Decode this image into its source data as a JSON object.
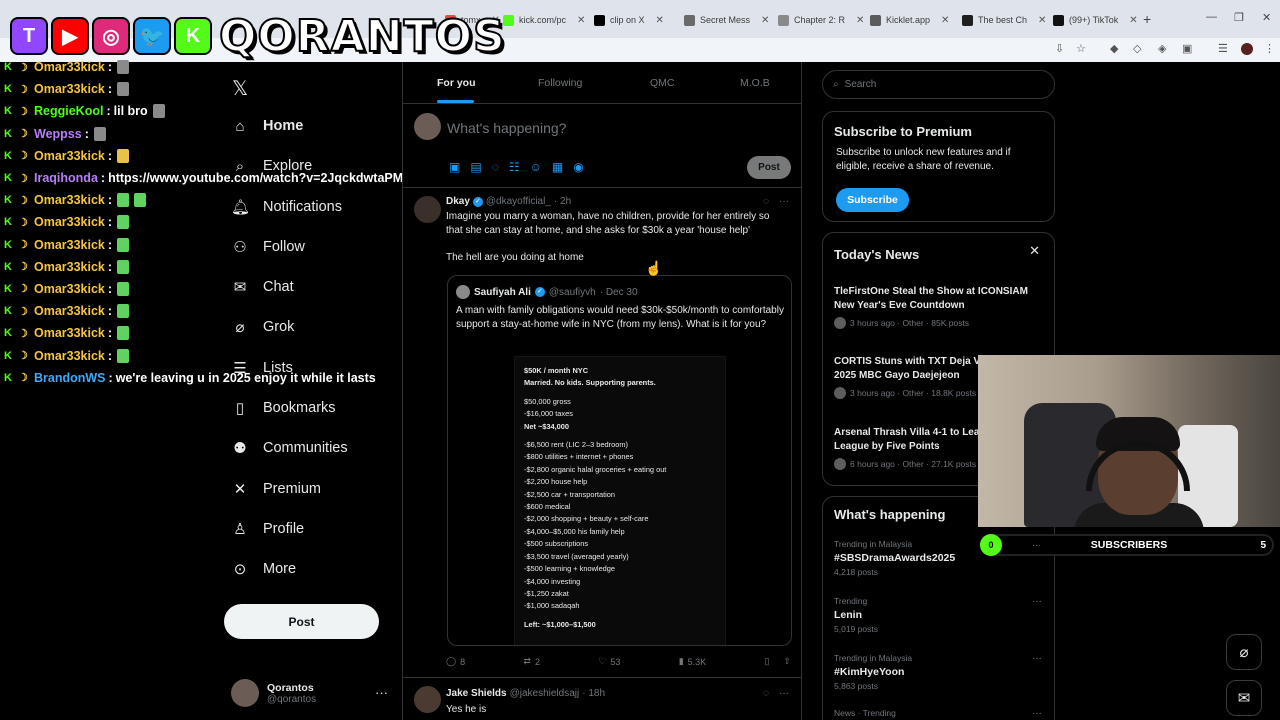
{
  "browser": {
    "tabs": [
      {
        "label": "tomx",
        "color": "#e54d42"
      },
      {
        "label": "kick.com/pc",
        "color": "#53fc18"
      },
      {
        "label": "clip on X",
        "color": "#000000"
      },
      {
        "label": "Secret Mess",
        "color": "#6a6a6a"
      },
      {
        "label": "Chapter 2: R",
        "color": "#8a8a8a"
      },
      {
        "label": "Kicklet.app",
        "color": "#5b5b5b"
      },
      {
        "label": "The best Ch",
        "color": "#1f1f1f"
      },
      {
        "label": "(99+) TikTok",
        "color": "#111111"
      }
    ]
  },
  "overlay": {
    "brand_icons": [
      {
        "name": "twitch-icon",
        "glyph": "T",
        "color": "#9146ff"
      },
      {
        "name": "youtube-icon",
        "glyph": "▶",
        "color": "#ff0000"
      },
      {
        "name": "instagram-icon",
        "glyph": "◎",
        "color": "#dd2a7b"
      },
      {
        "name": "twitter-icon",
        "glyph": "🐦",
        "color": "#1d9bf0"
      },
      {
        "name": "kick-icon",
        "glyph": "K",
        "color": "#53fc18"
      }
    ],
    "logo_text": "QORANTOS"
  },
  "chat": [
    {
      "user": "Omar33kick",
      "color": "#f5c542",
      "msg": "",
      "emote": "grey"
    },
    {
      "user": "Omar33kick",
      "color": "#f5c542",
      "msg": "",
      "emote": "grey"
    },
    {
      "user": "ReggieKool",
      "color": "#53fc18",
      "msg": "lil bro",
      "emote": "grey"
    },
    {
      "user": "Weppss",
      "color": "#b77ff5",
      "msg": "",
      "emote": "grey"
    },
    {
      "user": "Omar33kick",
      "color": "#f5c542",
      "msg": "",
      "emote": "gold"
    },
    {
      "user": "Iraqihonda",
      "color": "#b77ff5",
      "msg": "https://www.youtube.com/watch?v=2JqckdwtaPM",
      "emote": ""
    },
    {
      "user": "Omar33kick",
      "color": "#f5c542",
      "msg": "",
      "emote": "green2"
    },
    {
      "user": "Omar33kick",
      "color": "#f5c542",
      "msg": "",
      "emote": "green"
    },
    {
      "user": "Omar33kick",
      "color": "#f5c542",
      "msg": "",
      "emote": "green"
    },
    {
      "user": "Omar33kick",
      "color": "#f5c542",
      "msg": "",
      "emote": "green"
    },
    {
      "user": "Omar33kick",
      "color": "#f5c542",
      "msg": "",
      "emote": "green"
    },
    {
      "user": "Omar33kick",
      "color": "#f5c542",
      "msg": "",
      "emote": "green"
    },
    {
      "user": "Omar33kick",
      "color": "#f5c542",
      "msg": "",
      "emote": "green"
    },
    {
      "user": "Omar33kick",
      "color": "#f5c542",
      "msg": "",
      "emote": "green"
    },
    {
      "user": "BrandonWS",
      "color": "#3fa9f5",
      "msg": "we're leaving u in 2025 enjoy it while it lasts",
      "emote": ""
    }
  ],
  "nav": {
    "items": [
      {
        "label": "Home",
        "icon": "home-icon"
      },
      {
        "label": "Explore",
        "icon": "search-icon"
      },
      {
        "label": "Notifications",
        "icon": "bell-icon"
      },
      {
        "label": "Follow",
        "icon": "follow-icon"
      },
      {
        "label": "Chat",
        "icon": "mail-icon"
      },
      {
        "label": "Grok",
        "icon": "grok-icon"
      },
      {
        "label": "Lists",
        "icon": "list-icon"
      },
      {
        "label": "Bookmarks",
        "icon": "bookmark-icon"
      },
      {
        "label": "Communities",
        "icon": "communities-icon"
      },
      {
        "label": "Premium",
        "icon": "x-icon"
      },
      {
        "label": "Profile",
        "icon": "person-icon"
      },
      {
        "label": "More",
        "icon": "more-icon"
      }
    ],
    "post_label": "Post",
    "account_name": "Qorantos",
    "account_handle": "@qorantos"
  },
  "feed": {
    "tabs": [
      "For you",
      "Following",
      "QMC",
      "M.O.B"
    ],
    "composer_placeholder": "What's happening?",
    "composer_post": "Post",
    "tweet1": {
      "name": "Dkay",
      "handle": "@dkayofficial_",
      "time": "· 2h",
      "text": "Imagine you marry a woman, have no children, provide for her entirely so that she can stay at home, and she asks for $30k a year 'house help'",
      "text2": "The hell are you doing at home",
      "quote": {
        "name": "Saufiyah Ali",
        "handle": "@saufiyvh",
        "time": "· Dec 30",
        "text": "A man with family obligations would need $30k-$50k/month to comfortably support a stay-at-home wife in NYC (from my lens). What is it for you?",
        "image_lines": [
          {
            "t": "$50K / month NYC",
            "b": true
          },
          {
            "t": "Married. No kids. Supporting parents.",
            "b": true
          },
          {
            "t": "",
            "gap": true
          },
          {
            "t": "$50,000 gross"
          },
          {
            "t": "-$16,000 taxes"
          },
          {
            "t": "Net ~$34,000",
            "b": true
          },
          {
            "t": "",
            "gap": true
          },
          {
            "t": "-$6,500 rent (LIC 2–3 bedroom)"
          },
          {
            "t": "-$800 utilities + internet + phones"
          },
          {
            "t": "-$2,800 organic halal groceries + eating out"
          },
          {
            "t": "-$2,200 house help"
          },
          {
            "t": "-$2,500 car + transportation"
          },
          {
            "t": "-$600 medical"
          },
          {
            "t": "-$2,000 shopping + beauty + self-care"
          },
          {
            "t": "-$4,000–$5,000 his family help"
          },
          {
            "t": "-$500 subscriptions"
          },
          {
            "t": "-$3,500 travel (averaged yearly)"
          },
          {
            "t": "-$500 learning + knowledge"
          },
          {
            "t": "-$4,000 investing"
          },
          {
            "t": "-$1,250 zakat"
          },
          {
            "t": "-$1,000 sadaqah"
          },
          {
            "t": "",
            "gap": true
          },
          {
            "t": "Left: ~$1,000–$1,500",
            "b": true
          }
        ]
      },
      "replies": "8",
      "reposts": "2",
      "likes": "53",
      "views": "5.3K"
    },
    "tweet2": {
      "name": "Jake Shields",
      "handle": "@jakeshieldsajj",
      "time": "· 18h",
      "text": "Yes he is"
    }
  },
  "right": {
    "search_placeholder": "Search",
    "premium": {
      "title": "Subscribe to Premium",
      "body": "Subscribe to unlock new features and if eligible, receive a share of revenue.",
      "button": "Subscribe"
    },
    "news": {
      "title": "Today's News",
      "items": [
        {
          "headline": "TleFirstOne Steal the Show at ICONSIAM New Year's Eve Countdown",
          "meta": "3 hours ago · Other · 85K posts"
        },
        {
          "headline": "CORTIS Stuns with TXT Deja Vu Cover at 2025 MBC Gayo Daejejeon",
          "meta": "3 hours ago · Other · 18.8K posts"
        },
        {
          "headline": "Arsenal Thrash Villa 4-1 to Lead Premier League by Five Points",
          "meta": "6 hours ago · Other · 27.1K posts"
        }
      ]
    },
    "happening": {
      "title": "What's happening",
      "trends": [
        {
          "category": "Trending in Malaysia",
          "name": "#SBSDramaAwards2025",
          "posts": "4,218 posts"
        },
        {
          "category": "Trending",
          "name": "Lenin",
          "posts": "5,019 posts"
        },
        {
          "category": "Trending in Malaysia",
          "name": "#KimHyeYoon",
          "posts": "5,863 posts"
        },
        {
          "category": "News · Trending",
          "name": "",
          "posts": ""
        }
      ]
    }
  },
  "subscribers": {
    "label": "SUBSCRIBERS",
    "current": "0",
    "goal": "5"
  }
}
